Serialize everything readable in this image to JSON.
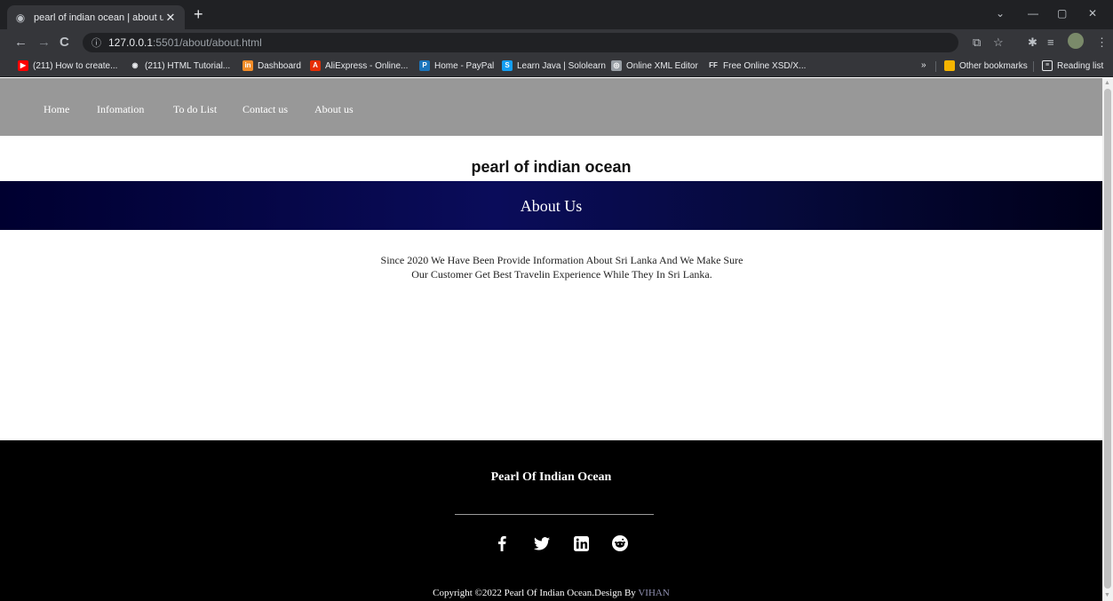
{
  "browser": {
    "tab_title": "pearl of indian ocean | about us",
    "url_host": "127.0.0.1",
    "url_path": ":5501/about/about.html",
    "bookmarks": [
      {
        "label": "(211) How to create...",
        "icon": "youtube-icon",
        "color": "#ff0000"
      },
      {
        "label": "(211) HTML Tutorial...",
        "icon": "globe-icon",
        "color": "#e8eaed"
      },
      {
        "label": "Dashboard",
        "icon": "dashboard-icon",
        "color": "#f28c28"
      },
      {
        "label": "AliExpress - Online...",
        "icon": "aliexpress-icon",
        "color": "#e62e04"
      },
      {
        "label": "Home - PayPal",
        "icon": "paypal-icon",
        "color": "#1b75bc"
      },
      {
        "label": "Learn Java | Sololearn",
        "icon": "sololearn-icon",
        "color": "#149ef2"
      },
      {
        "label": "Online XML Editor",
        "icon": "xml-editor-icon",
        "color": "#9aa0a6"
      },
      {
        "label": "Free Online XSD/X...",
        "icon": "ff-icon",
        "color": "#e8eaed"
      }
    ],
    "more_bookmarks": "»",
    "other_bookmarks": "Other bookmarks",
    "reading_list": "Reading list"
  },
  "nav": {
    "items": [
      "Home",
      "Infomation",
      "To do List",
      "Contact us",
      "About us"
    ]
  },
  "brand": "pearl of indian ocean",
  "about": {
    "heading": "About Us",
    "body": "Since 2020 We Have Been Provide Information About Sri Lanka And We Make Sure Our Customer Get Best Travelin Experience While They In Sri Lanka."
  },
  "footer": {
    "title": "Pearl Of Indian Ocean",
    "social": [
      "facebook-icon",
      "twitter-icon",
      "linkedin-icon",
      "reddit-icon"
    ],
    "copyright_prefix": "Copyright ©2022 Pearl Of Indian Ocean.Design By",
    "author": "VIHAN"
  },
  "colors": {
    "nav_bg": "#989898",
    "about_band": "#0a0c5a",
    "footer_bg": "#000000"
  }
}
